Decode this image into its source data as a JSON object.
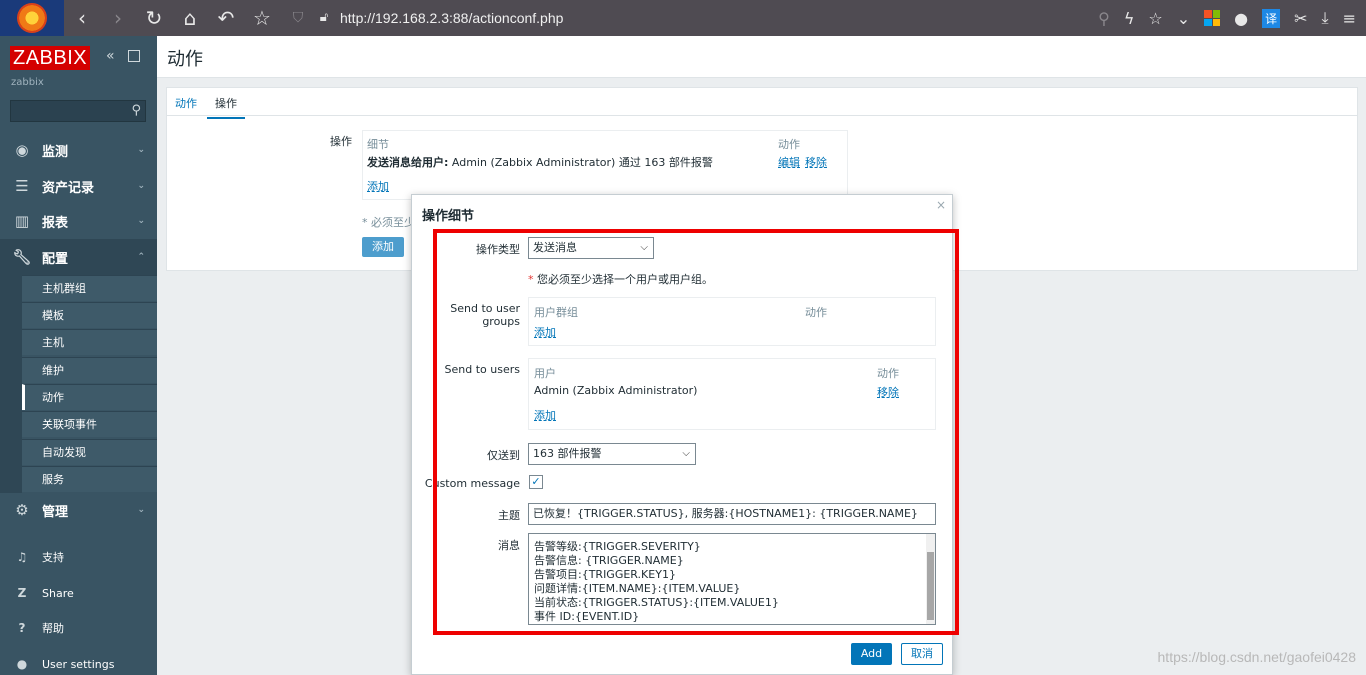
{
  "browser": {
    "url": "http://192.168.2.3:88/actionconf.php",
    "translate_label": "译"
  },
  "sidebar": {
    "brand": "ZABBIX",
    "user": "zabbix",
    "nav": [
      {
        "label": "监测"
      },
      {
        "label": "资产记录"
      },
      {
        "label": "报表"
      },
      {
        "label": "配置"
      },
      {
        "label": "管理"
      }
    ],
    "sub": [
      "主机群组",
      "模板",
      "主机",
      "维护",
      "动作",
      "关联项事件",
      "自动发现",
      "服务"
    ],
    "bottom": [
      {
        "label": "支持"
      },
      {
        "label": "Share"
      },
      {
        "label": "帮助"
      },
      {
        "label": "User settings"
      }
    ]
  },
  "page": {
    "title": "动作",
    "tabs": [
      "动作",
      "操作"
    ],
    "ops_label": "操作",
    "col_detail": "细节",
    "col_action": "动作",
    "op_bold": "发送消息给用户:",
    "op_text": " Admin (Zabbix Administrator) 通过 163 部件报警",
    "edit": "编辑",
    "remove": "移除",
    "add_link": "添加",
    "required_note": "* 必须至少",
    "add_button": "添加"
  },
  "dialog": {
    "title": "操作细节",
    "close": "×",
    "op_type_label": "操作类型",
    "op_type_value": "发送消息",
    "warning": "您必须至少选择一个用户或用户组。",
    "groups_label": "Send to user groups",
    "groups_col1": "用户群组",
    "groups_col2": "动作",
    "groups_add": "添加",
    "users_label": "Send to users",
    "users_col1": "用户",
    "users_col2": "动作",
    "user_name": "Admin (Zabbix Administrator)",
    "user_remove": "移除",
    "users_add": "添加",
    "send_only_label": "仅送到",
    "send_only_value": "163 部件报警",
    "custom_label": "Custom message",
    "subject_label": "主题",
    "subject_value": "已恢复！{TRIGGER.STATUS}, 服务器:{HOSTNAME1}: {TRIGGER.NAME}",
    "message_label": "消息",
    "message_lines": [
      "告警等级:{TRIGGER.SEVERITY}",
      "告警信息: {TRIGGER.NAME}",
      "告警项目:{TRIGGER.KEY1}",
      "问题详情:{ITEM.NAME}:{ITEM.VALUE}",
      "当前状态:{TRIGGER.STATUS}:{ITEM.VALUE1}",
      "事件 ID:{EVENT.ID}"
    ],
    "add_button": "Add",
    "cancel_button": "取消"
  },
  "watermark": "https://blog.csdn.net/gaofei0428",
  "colors": {
    "brand_red": "#d40000",
    "accent": "#0275b8",
    "highlight": "#ee0000",
    "sidebar": "#395463"
  }
}
